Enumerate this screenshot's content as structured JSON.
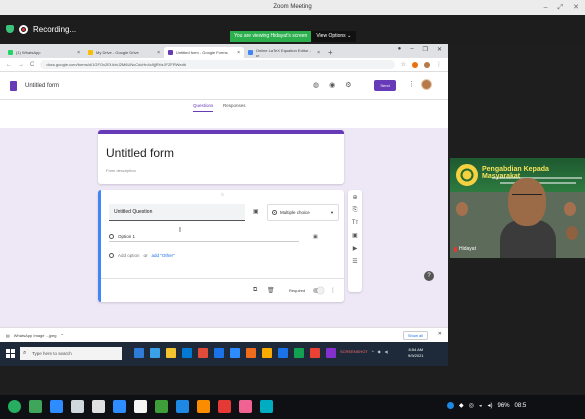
{
  "zoom": {
    "window_title": "Zoom Meeting",
    "recording_label": "Recording...",
    "viewing_notice": "You are viewing Hidayat's screen",
    "view_options": "View Options ⌄"
  },
  "browser": {
    "tabs": [
      {
        "label": "(1) WhatsApp",
        "color": "#25d366"
      },
      {
        "label": "My Drive - Google Drive",
        "color": "#fbbc04"
      },
      {
        "label": "Untitled form - Google Forms",
        "color": "#673ab7"
      },
      {
        "label": "Online LaTeX Equation Editor - cr",
        "color": "#4285f4"
      }
    ],
    "url": "docs.google.com/forms/d/1GFOx2Ef-ibbJ2M6UNcCdcHn4c9jjRHzJFZFRWedit"
  },
  "forms": {
    "app_title": "Untitled form",
    "send_label": "Send",
    "tab_questions": "Questions",
    "tab_responses": "Responses",
    "form_title": "Untitled form",
    "form_description": "Form description",
    "question_title": "Untitled Question",
    "question_type": "Multiple choice",
    "option_1": "Option 1",
    "add_option": "Add option",
    "or": "or",
    "add_other": "add \"Other\"",
    "required_label": "Required"
  },
  "downloads": {
    "file_name": "WhatsApp Image ...jpeg",
    "show_all": "Show all"
  },
  "windows": {
    "search_placeholder": "Type here to search",
    "tray_text": "SCREENSHOT",
    "clock_time": "8:54 AM",
    "clock_date": "9/9/2021"
  },
  "video": {
    "banner_title": "Pengabdian Kepada Masyarakat",
    "participant_name": "Hidayat"
  },
  "local_tray": {
    "battery": "96%",
    "time": "08:5"
  }
}
